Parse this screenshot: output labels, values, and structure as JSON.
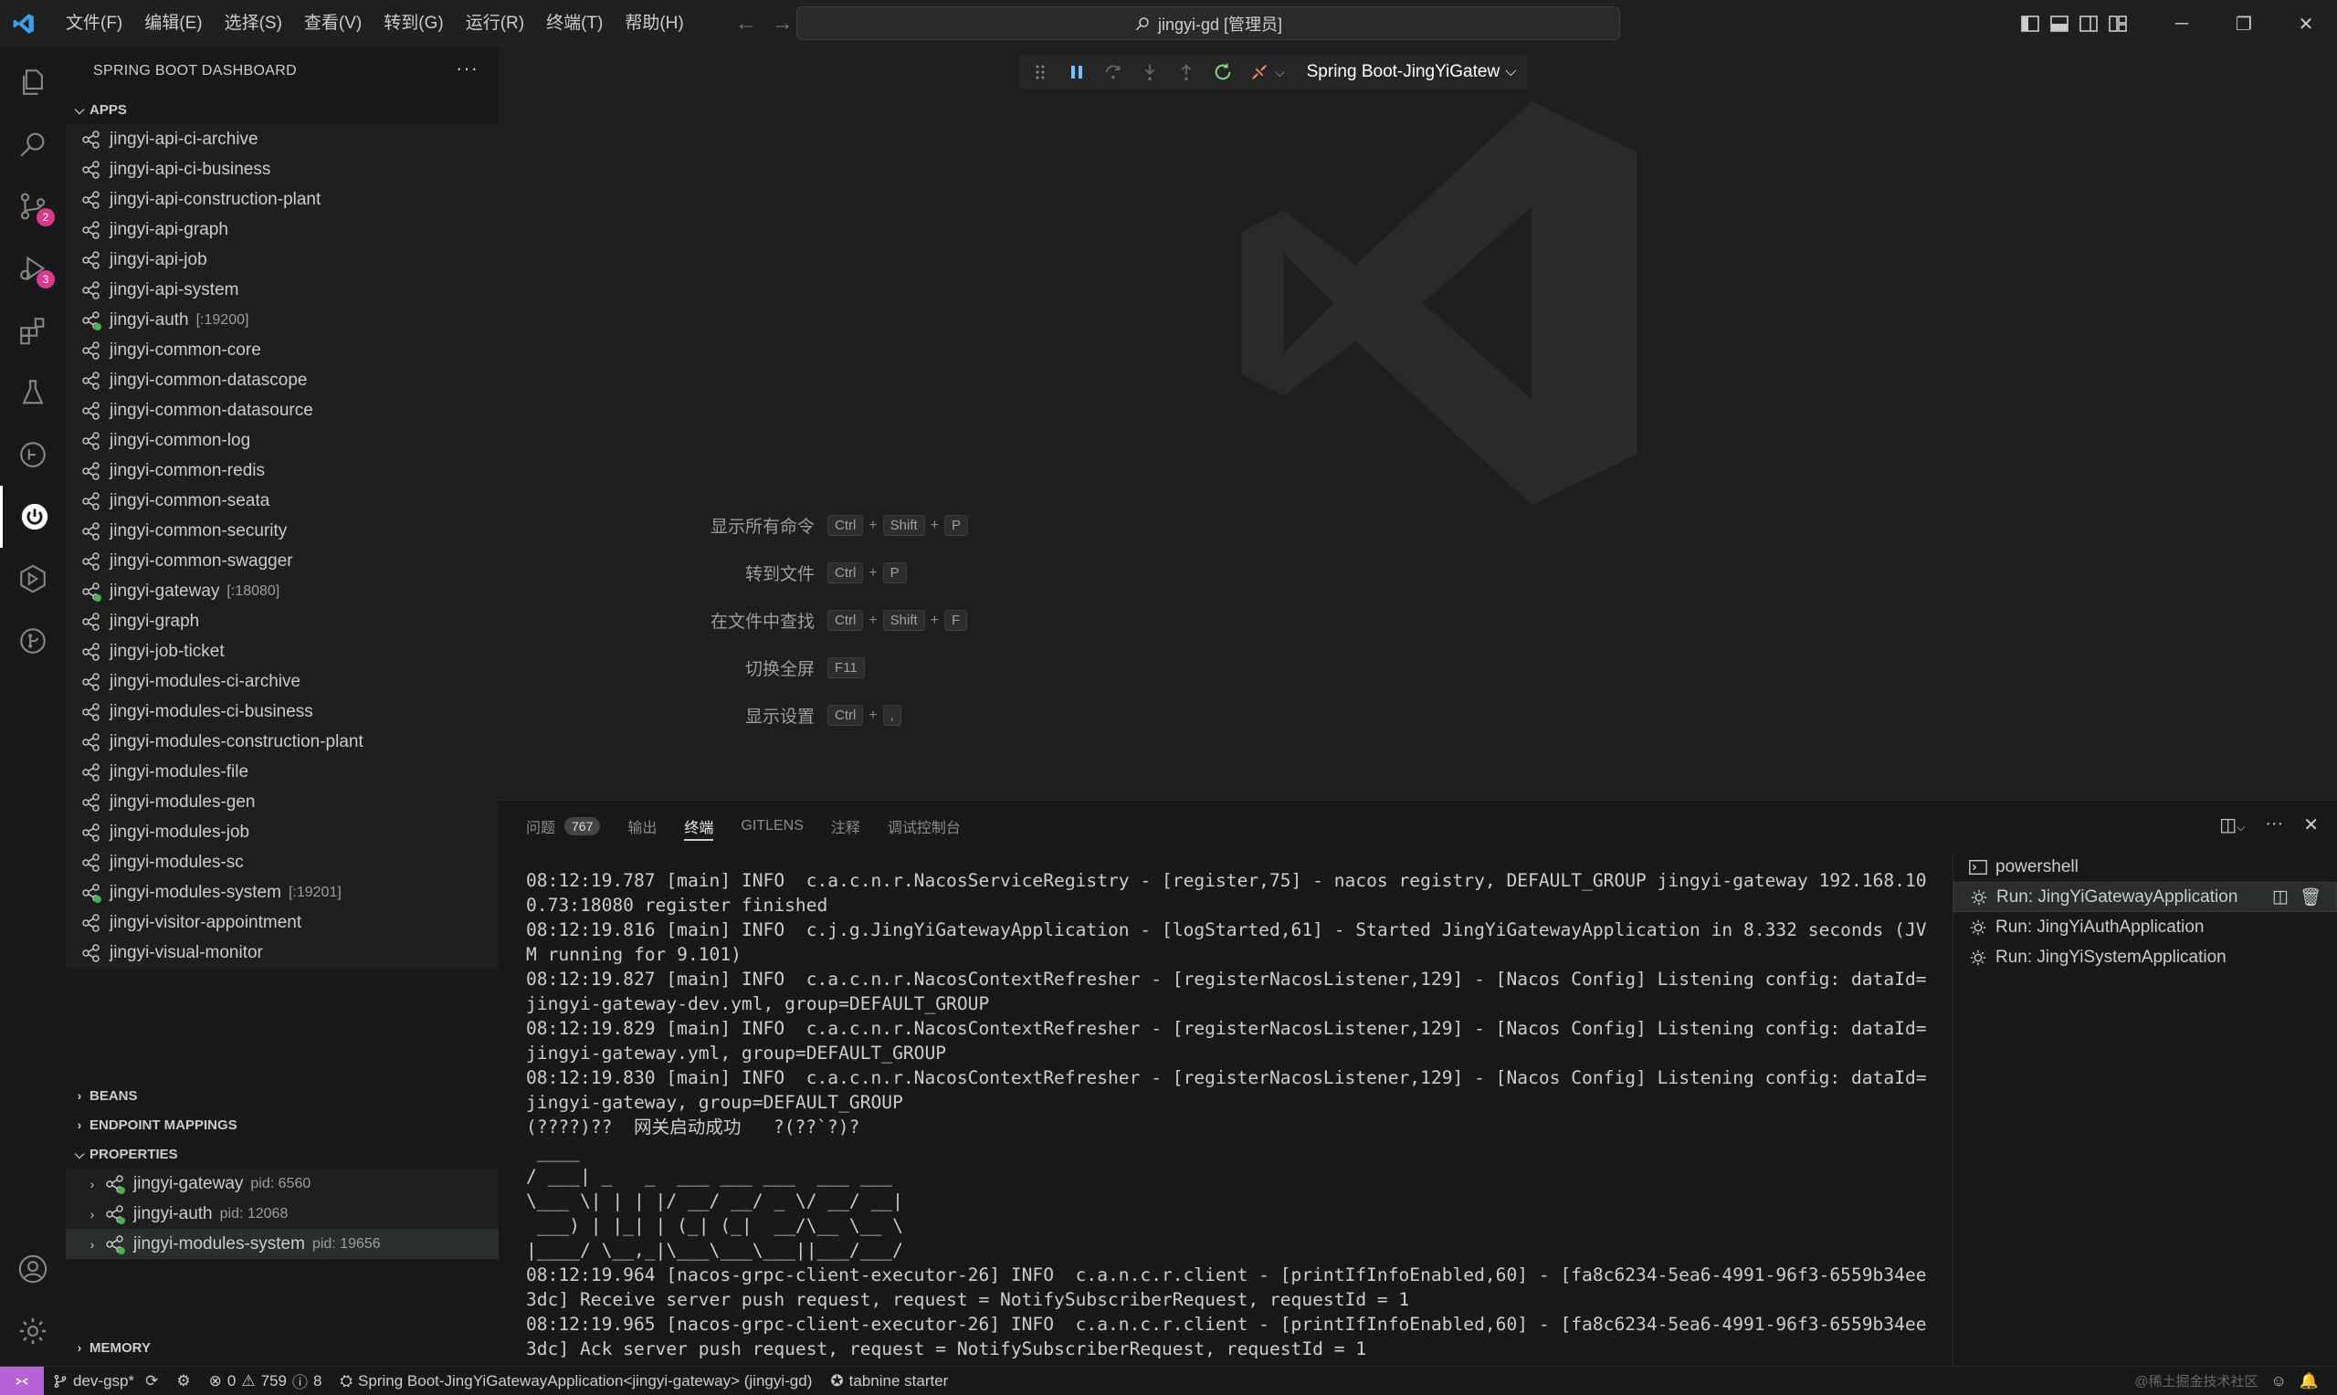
{
  "titlebar": {
    "menu": [
      "文件(F)",
      "编辑(E)",
      "选择(S)",
      "查看(V)",
      "转到(G)",
      "运行(R)",
      "终端(T)",
      "帮助(H)"
    ],
    "search": "jingyi-gd [管理员]"
  },
  "activity": {
    "scm_badge": "2",
    "debug_badge": "3"
  },
  "sidebar": {
    "title": "SPRING BOOT DASHBOARD",
    "apps_header": "APPS",
    "apps": [
      {
        "name": "jingyi-api-ci-archive",
        "port": ""
      },
      {
        "name": "jingyi-api-ci-business",
        "port": ""
      },
      {
        "name": "jingyi-api-construction-plant",
        "port": ""
      },
      {
        "name": "jingyi-api-graph",
        "port": ""
      },
      {
        "name": "jingyi-api-job",
        "port": ""
      },
      {
        "name": "jingyi-api-system",
        "port": ""
      },
      {
        "name": "jingyi-auth",
        "port": "[:19200]"
      },
      {
        "name": "jingyi-common-core",
        "port": ""
      },
      {
        "name": "jingyi-common-datascope",
        "port": ""
      },
      {
        "name": "jingyi-common-datasource",
        "port": ""
      },
      {
        "name": "jingyi-common-log",
        "port": ""
      },
      {
        "name": "jingyi-common-redis",
        "port": ""
      },
      {
        "name": "jingyi-common-seata",
        "port": ""
      },
      {
        "name": "jingyi-common-security",
        "port": ""
      },
      {
        "name": "jingyi-common-swagger",
        "port": ""
      },
      {
        "name": "jingyi-gateway",
        "port": "[:18080]"
      },
      {
        "name": "jingyi-graph",
        "port": ""
      },
      {
        "name": "jingyi-job-ticket",
        "port": ""
      },
      {
        "name": "jingyi-modules-ci-archive",
        "port": ""
      },
      {
        "name": "jingyi-modules-ci-business",
        "port": ""
      },
      {
        "name": "jingyi-modules-construction-plant",
        "port": ""
      },
      {
        "name": "jingyi-modules-file",
        "port": ""
      },
      {
        "name": "jingyi-modules-gen",
        "port": ""
      },
      {
        "name": "jingyi-modules-job",
        "port": ""
      },
      {
        "name": "jingyi-modules-sc",
        "port": ""
      },
      {
        "name": "jingyi-modules-system",
        "port": "[:19201]"
      },
      {
        "name": "jingyi-visitor-appointment",
        "port": ""
      },
      {
        "name": "jingyi-visual-monitor",
        "port": ""
      }
    ],
    "beans_header": "BEANS",
    "endpoint_header": "ENDPOINT MAPPINGS",
    "properties_header": "PROPERTIES",
    "properties": [
      {
        "name": "jingyi-gateway",
        "pid": "pid: 6560"
      },
      {
        "name": "jingyi-auth",
        "pid": "pid: 12068"
      },
      {
        "name": "jingyi-modules-system",
        "pid": "pid: 19656"
      }
    ],
    "memory_header": "MEMORY"
  },
  "debug_toolbar": {
    "config": "Spring Boot-JingYiGatew"
  },
  "shortcuts": [
    {
      "label": "显示所有命令",
      "keys": [
        "Ctrl",
        "Shift",
        "P"
      ]
    },
    {
      "label": "转到文件",
      "keys": [
        "Ctrl",
        "P"
      ]
    },
    {
      "label": "在文件中查找",
      "keys": [
        "Ctrl",
        "Shift",
        "F"
      ]
    },
    {
      "label": "切换全屏",
      "keys": [
        "F11"
      ]
    },
    {
      "label": "显示设置",
      "keys": [
        "Ctrl",
        ","
      ]
    }
  ],
  "panel": {
    "tabs": [
      "问题",
      "输出",
      "终端",
      "GITLENS",
      "注释",
      "调试控制台"
    ],
    "problems_count": "767",
    "terminal_text": "08:12:19.787 [main] INFO  c.a.c.n.r.NacosServiceRegistry - [register,75] - nacos registry, DEFAULT_GROUP jingyi-gateway 192.168.100.73:18080 register finished\n08:12:19.816 [main] INFO  c.j.g.JingYiGatewayApplication - [logStarted,61] - Started JingYiGatewayApplication in 8.332 seconds (JVM running for 9.101)\n08:12:19.827 [main] INFO  c.a.c.n.r.NacosContextRefresher - [registerNacosListener,129] - [Nacos Config] Listening config: dataId=jingyi-gateway-dev.yml, group=DEFAULT_GROUP\n08:12:19.829 [main] INFO  c.a.c.n.r.NacosContextRefresher - [registerNacosListener,129] - [Nacos Config] Listening config: dataId=jingyi-gateway.yml, group=DEFAULT_GROUP\n08:12:19.830 [main] INFO  c.a.c.n.r.NacosContextRefresher - [registerNacosListener,129] - [Nacos Config] Listening config: dataId=jingyi-gateway, group=DEFAULT_GROUP\n(????)??  网关启动成功   ?(??`?)?\n ____\n/ ___| _   _  ___ ___ ___  ___ ___\n\\___ \\| | | |/ __/ __/ _ \\/ __/ __|\n ___) | |_| | (_| (_|  __/\\__ \\__ \\\n|____/ \\__,_|\\___\\___\\___||___/___/\n08:12:19.964 [nacos-grpc-client-executor-26] INFO  c.a.n.c.r.client - [printIfInfoEnabled,60] - [fa8c6234-5ea6-4991-96f3-6559b34ee3dc] Receive server push request, request = NotifySubscriberRequest, requestId = 1\n08:12:19.965 [nacos-grpc-client-executor-26] INFO  c.a.n.c.r.client - [printIfInfoEnabled,60] - [fa8c6234-5ea6-4991-96f3-6559b34ee3dc] Ack server push request, request = NotifySubscriberRequest, requestId = 1",
    "terminals": [
      "powershell",
      "Run: JingYiGatewayApplication",
      "Run: JingYiAuthApplication",
      "Run: JingYiSystemApplication"
    ]
  },
  "statusbar": {
    "branch": "dev-gsp*",
    "errors": "0",
    "warnings": "759",
    "info": "8",
    "run_config": "Spring Boot-JingYiGatewayApplication<jingyi-gateway> (jingyi-gd)",
    "tabnine": "tabnine starter",
    "watermark": "@稀土掘金技术社区"
  },
  "colors": {
    "accent": "#b462d6",
    "badge": "#d23c8a",
    "app_icon": "#c5c5c5",
    "running_dot": "#4caf50"
  }
}
